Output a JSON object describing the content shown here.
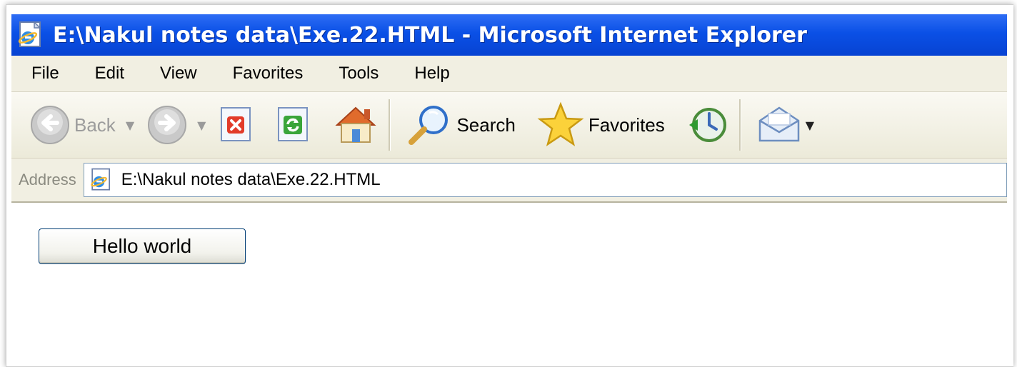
{
  "window": {
    "title": "E:\\Nakul notes data\\Exe.22.HTML - Microsoft Internet Explorer",
    "icon": "ie-page-icon"
  },
  "menu": {
    "items": [
      "File",
      "Edit",
      "View",
      "Favorites",
      "Tools",
      "Help"
    ]
  },
  "toolbar": {
    "back_label": "Back",
    "search_label": "Search",
    "favorites_label": "Favorites",
    "icons": {
      "back": "back-arrow-icon",
      "forward": "forward-arrow-icon",
      "stop": "stop-icon",
      "refresh": "refresh-icon",
      "home": "home-icon",
      "search": "magnifier-icon",
      "favorites": "star-icon",
      "history": "history-icon",
      "mail": "mail-icon"
    }
  },
  "address": {
    "label": "Address",
    "value": "E:\\Nakul notes data\\Exe.22.HTML"
  },
  "content": {
    "button_label": "Hello world"
  },
  "colors": {
    "titlebar": "#0a50e6",
    "chrome": "#f1efe2",
    "button_border": "#003c74"
  }
}
